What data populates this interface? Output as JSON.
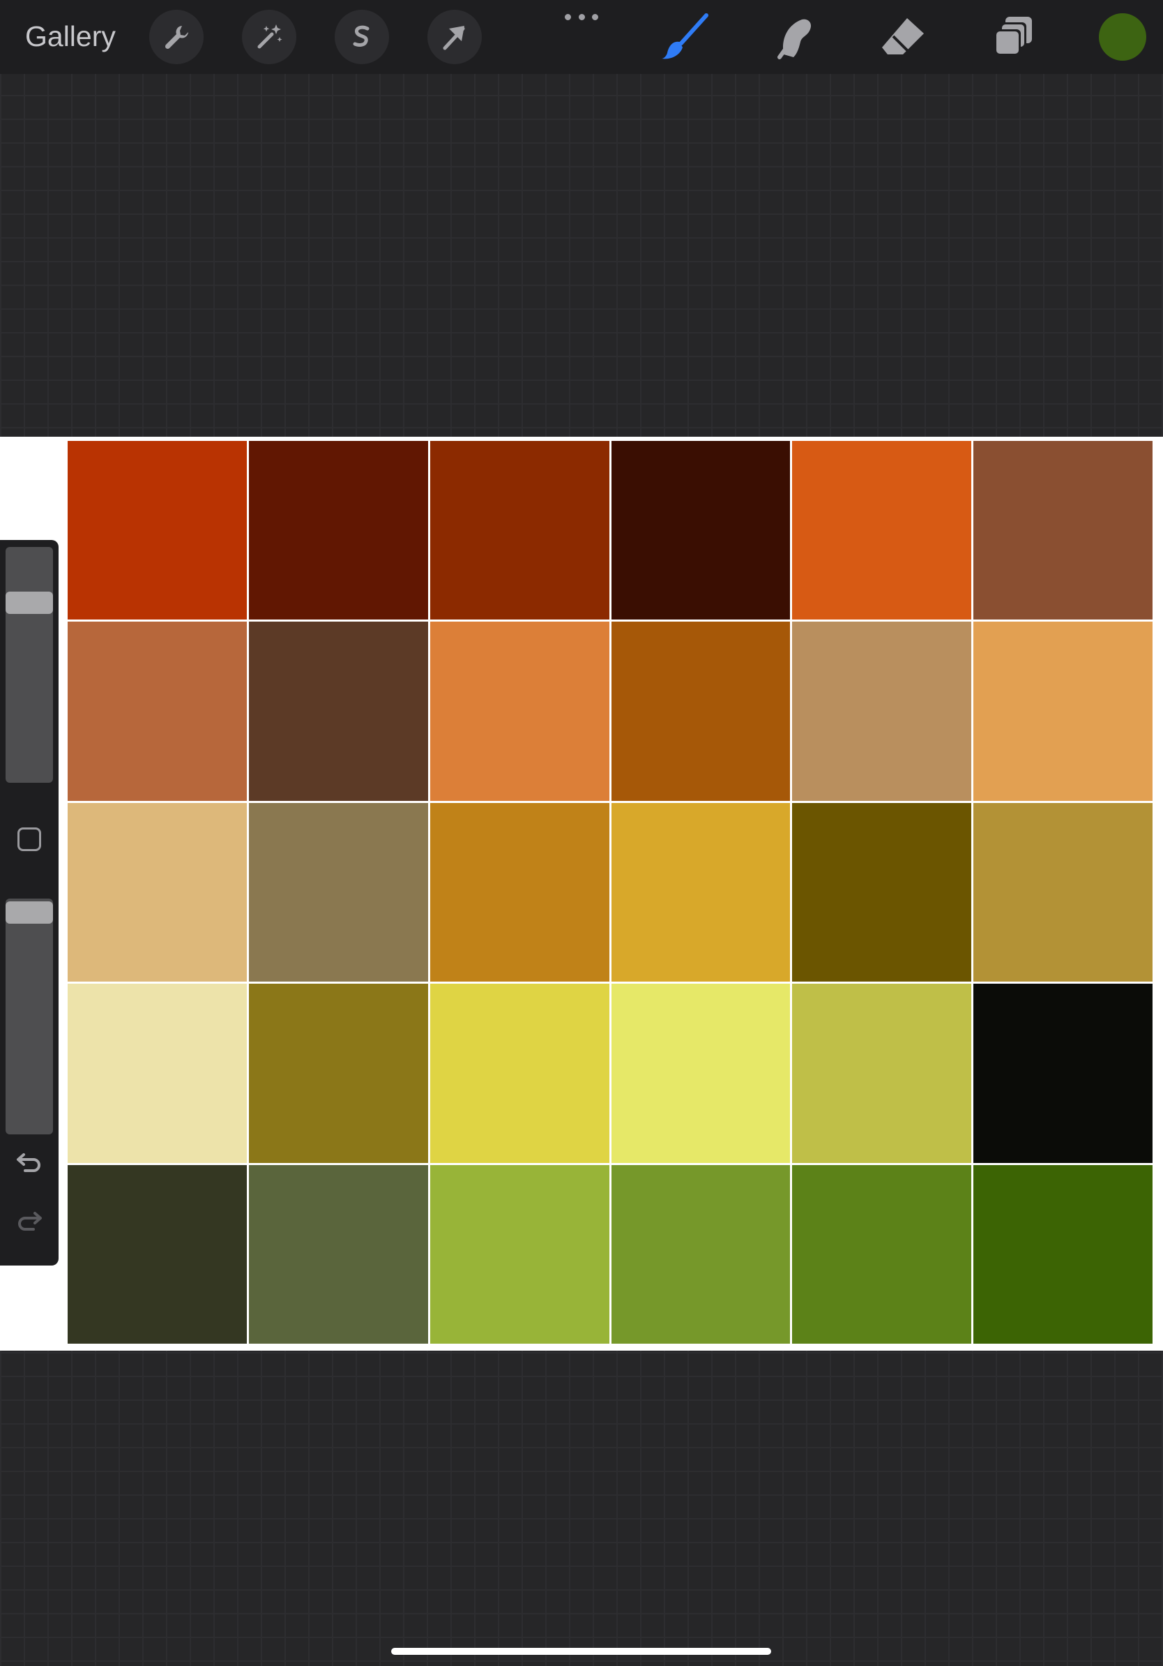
{
  "toolbar": {
    "gallery_label": "Gallery",
    "left_tools": [
      {
        "name": "actions",
        "icon": "wrench-icon"
      },
      {
        "name": "adjustments",
        "icon": "magic-wand-icon"
      },
      {
        "name": "selection",
        "icon": "selection-s-icon"
      },
      {
        "name": "transform",
        "icon": "arrow-cursor-icon"
      }
    ],
    "more_icon": "more-dots-icon",
    "right_tools": [
      {
        "name": "brush",
        "icon": "brush-icon",
        "active": true,
        "color": "#2f7cf6"
      },
      {
        "name": "smudge",
        "icon": "smudge-icon",
        "active": false
      },
      {
        "name": "eraser",
        "icon": "eraser-icon",
        "active": false
      },
      {
        "name": "layers",
        "icon": "layers-icon",
        "active": false
      }
    ],
    "current_color": "#3d6412"
  },
  "canvas": {
    "background": "#ffffff",
    "palette": [
      [
        "#b93302",
        "#611702",
        "#8c2a00",
        "#3a0e02",
        "#d75a14",
        "#8a4f31"
      ],
      [
        "#b7673b",
        "#5c3a26",
        "#dc7f38",
        "#a65808",
        "#b98f5e",
        "#e2a052"
      ],
      [
        "#ddb87a",
        "#8a7850",
        "#c08218",
        "#d8a82a",
        "#6b5500",
        "#b39236"
      ],
      [
        "#ede3aa",
        "#8b7718",
        "#dfd444",
        "#e6e868",
        "#bfbf48",
        "#0b0c08"
      ],
      [
        "#343722",
        "#5a653c",
        "#98b438",
        "#76982a",
        "#5c8218",
        "#3c6404"
      ]
    ]
  },
  "sidebar": {
    "brush_size": 0.8,
    "opacity": 1.0,
    "modifier_icon": "square-modifier-icon",
    "undo_icon": "undo-icon",
    "redo_icon": "redo-icon",
    "redo_enabled": false
  }
}
